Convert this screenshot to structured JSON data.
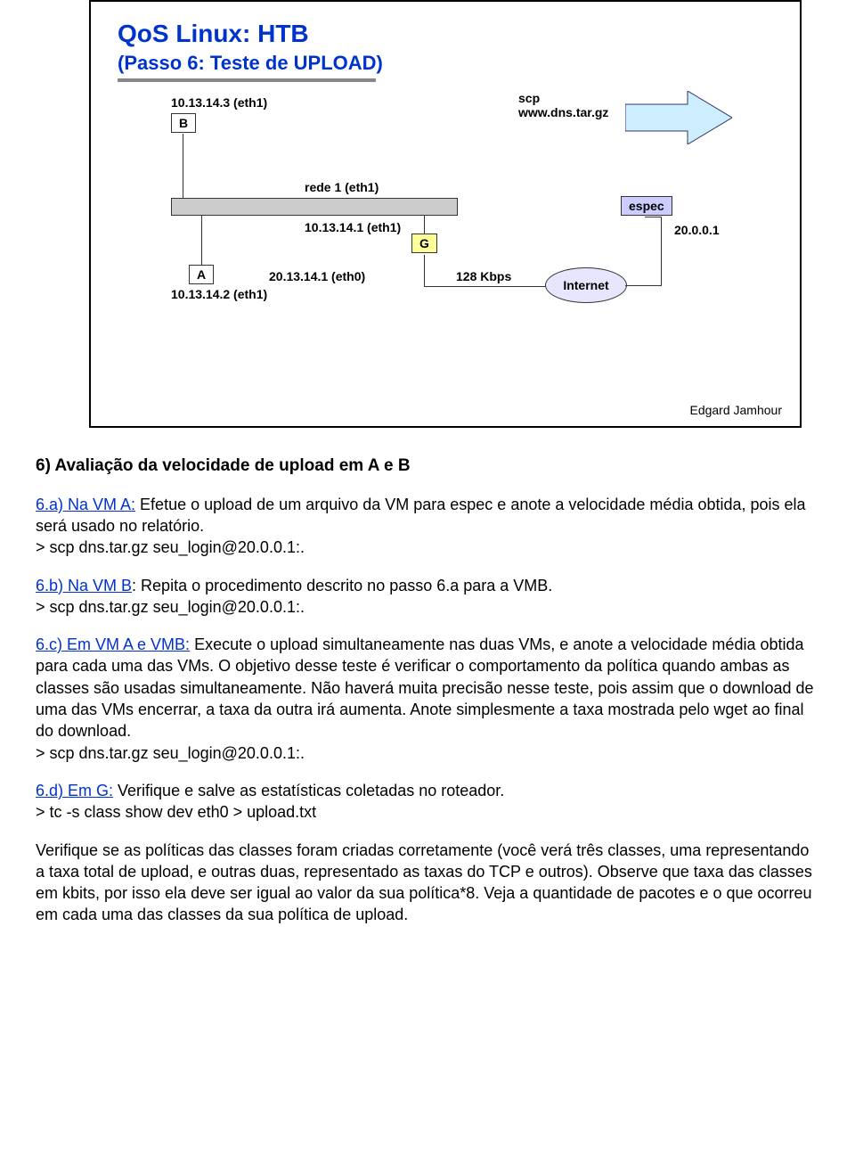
{
  "slide": {
    "title": "QoS Linux: HTB",
    "subtitle": "(Passo 6: Teste de UPLOAD)",
    "author": "Edgard Jamhour",
    "nodes": {
      "b_label": "B",
      "b_ip": "10.13.14.3 (eth1)",
      "a_label": "A",
      "a_ip": "10.13.14.2 (eth1)",
      "g_label": "G",
      "g_eth1": "10.13.14.1 (eth1)",
      "g_eth0": "20.13.14.1 (eth0)",
      "rede_label": "rede 1 (eth1)",
      "bandwidth": "128 Kbps",
      "internet": "Internet",
      "espec_label": "espec",
      "espec_ip": "20.0.0.1",
      "scp_line1": "scp",
      "scp_line2": "www.dns.tar.gz"
    }
  },
  "body": {
    "h6": "6) Avaliação da velocidade de upload em A e B",
    "p6a_lead": "6.a) Na VM A:",
    "p6a_text": " Efetue o upload de um arquivo da VM para espec e anote a velocidade média obtida, pois ela será usado no relatório.",
    "p6a_cmd": "> scp dns.tar.gz seu_login@20.0.0.1:.",
    "p6b_lead": "6.b) Na VM B",
    "p6b_text": ": Repita o procedimento descrito no passo 6.a para a VMB.",
    "p6b_cmd": "> scp dns.tar.gz seu_login@20.0.0.1:.",
    "p6c_lead": "6.c) Em VM A e VMB:",
    "p6c_text": " Execute o upload simultaneamente nas duas VMs, e anote a velocidade média obtida para cada uma das VMs. O objetivo desse teste é verificar o comportamento da política quando ambas as classes são usadas simultaneamente. Não haverá muita precisão nesse teste, pois assim que o download de uma das VMs encerrar, a taxa da outra irá aumenta. Anote simplesmente a taxa mostrada pelo wget ao final do download.",
    "p6c_cmd": "> scp dns.tar.gz seu_login@20.0.0.1:.",
    "p6d_lead": "6.d) Em G:",
    "p6d_text": " Verifique e salve as estatísticas coletadas no roteador.",
    "p6d_cmd": "> tc -s class show dev eth0 > upload.txt",
    "p_verify": "Verifique se as políticas das classes foram criadas corretamente (você verá três classes, uma representando a taxa total de upload, e outras duas, representado as taxas do TCP e outros). Observe que taxa das classes em kbits, por isso ela deve ser igual ao valor da sua política*8. Veja a quantidade de pacotes e o que ocorreu em cada uma das classes da sua política de upload."
  }
}
